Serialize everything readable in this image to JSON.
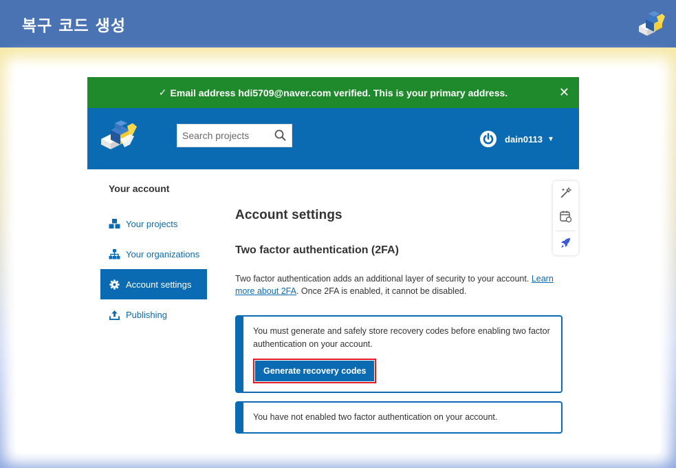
{
  "page": {
    "title": "복구 코드 생성"
  },
  "flash": {
    "check": "✓",
    "message": "Email address hdi5709@naver.com verified. This is your primary address.",
    "close": "✕"
  },
  "header": {
    "search_placeholder": "Search projects",
    "username": "dain0113",
    "caret": "▼"
  },
  "sidebar": {
    "heading": "Your account",
    "items": [
      {
        "label": "Your projects",
        "icon": "cubes-icon",
        "active": false
      },
      {
        "label": "Your organizations",
        "icon": "sitemap-icon",
        "active": false
      },
      {
        "label": "Account settings",
        "icon": "gear-icon",
        "active": true
      },
      {
        "label": "Publishing",
        "icon": "upload-icon",
        "active": false
      }
    ]
  },
  "main": {
    "title": "Account settings",
    "section_title": "Two factor authentication (2FA)",
    "desc_before": "Two factor authentication adds an additional layer of security to your account. ",
    "desc_link": "Learn more about 2FA",
    "desc_after": ". Once 2FA is enabled, it cannot be disabled.",
    "callout_msg": "You must generate and safely store recovery codes before enabling two factor authentication on your account.",
    "button_label": "Generate recovery codes",
    "callout2_msg": "You have not enabled two factor authentication on your account."
  },
  "colors": {
    "title_bar": "#4a73b4",
    "flash_green": "#1f8a2c",
    "brand_blue": "#0a6bb3",
    "highlight_red": "#e21a26"
  }
}
